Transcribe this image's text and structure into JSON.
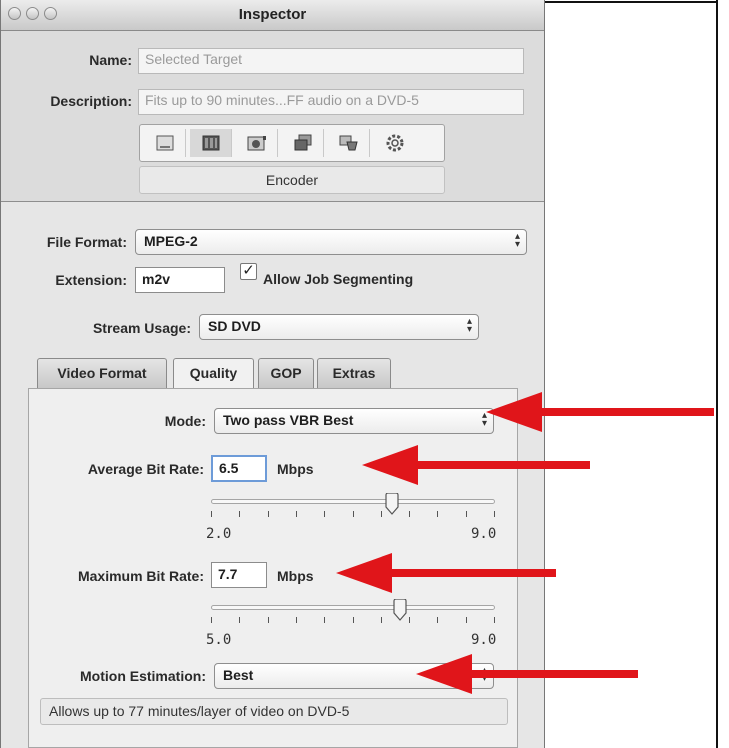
{
  "window": {
    "title": "Inspector"
  },
  "target": {
    "name_label": "Name:",
    "name_value": "Selected Target",
    "description_label": "Description:",
    "description_value": "Fits up to 90 minutes...FF audio on a DVD-5"
  },
  "toolbar": {
    "icons": [
      "summary-icon",
      "encoder-icon",
      "frame-controls-icon",
      "filters-icon",
      "geometry-icon",
      "actions-icon"
    ],
    "selected_label": "Encoder"
  },
  "encoder": {
    "file_format_label": "File Format:",
    "file_format_value": "MPEG-2",
    "extension_label": "Extension:",
    "extension_value": "m2v",
    "allow_segmenting_label": "Allow Job Segmenting",
    "allow_segmenting_checked": true,
    "stream_usage_label": "Stream Usage:",
    "stream_usage_value": "SD DVD"
  },
  "tabs": [
    {
      "label": "Video Format",
      "active": false
    },
    {
      "label": "Quality",
      "active": true
    },
    {
      "label": "GOP",
      "active": false
    },
    {
      "label": "Extras",
      "active": false
    }
  ],
  "quality": {
    "mode_label": "Mode:",
    "mode_value": "Two pass VBR Best",
    "avg_label": "Average Bit Rate:",
    "avg_value": "6.5",
    "avg_unit": "Mbps",
    "avg_slider_min": "2.0",
    "avg_slider_max": "9.0",
    "avg_slider_value": 6.5,
    "max_label": "Maximum Bit Rate:",
    "max_value": "7.7",
    "max_unit": "Mbps",
    "max_slider_min": "5.0",
    "max_slider_max": "9.0",
    "max_slider_value": 7.7,
    "motion_label": "Motion Estimation:",
    "motion_value": "Best",
    "status_text": "Allows up to 77 minutes/layer of video on DVD-5"
  },
  "colors": {
    "annotation_arrow": "#e0151a",
    "window_bg": "#e6e6e6"
  }
}
